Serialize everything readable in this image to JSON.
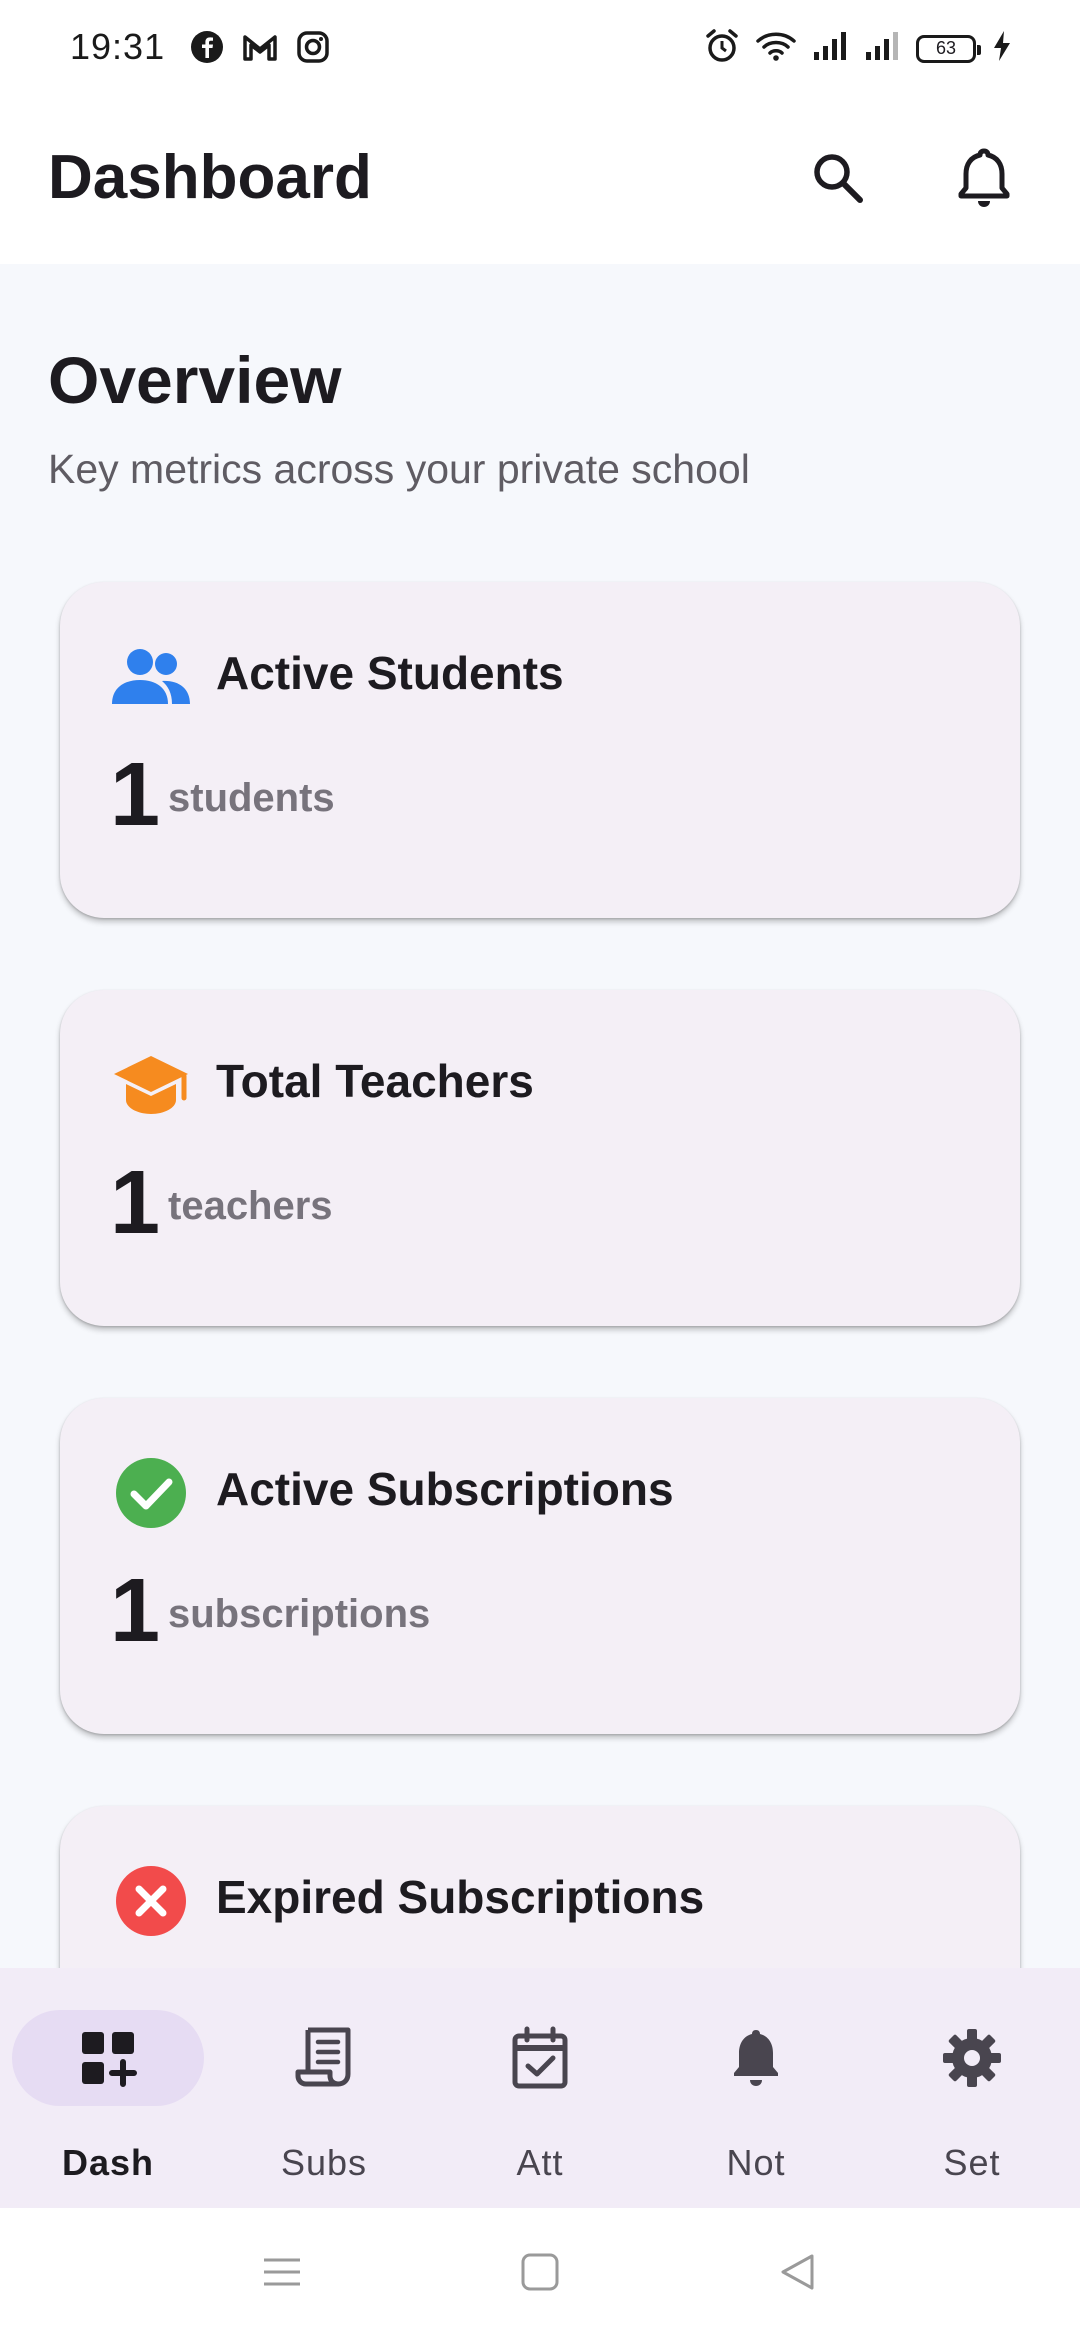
{
  "status_bar": {
    "time": "19:31",
    "app_icons": [
      "facebook-icon",
      "gmail-icon",
      "instagram-icon"
    ],
    "system_icons": [
      "alarm-icon",
      "wifi-icon",
      "signal-icon",
      "signal-icon"
    ],
    "battery": "63"
  },
  "app_bar": {
    "title": "Dashboard",
    "actions": [
      "search-icon",
      "bell-icon"
    ]
  },
  "overview": {
    "title": "Overview",
    "subtitle": "Key metrics across your private school"
  },
  "cards": [
    {
      "icon": "people-icon",
      "icon_color": "#2f80ed",
      "title": "Active Students",
      "value": "1",
      "unit": "students"
    },
    {
      "icon": "graduation-cap-icon",
      "icon_color": "#f68b1f",
      "title": "Total Teachers",
      "value": "1",
      "unit": "teachers"
    },
    {
      "icon": "check-circle-icon",
      "icon_color": "#4caf50",
      "title": "Active Subscriptions",
      "value": "1",
      "unit": "subscriptions"
    },
    {
      "icon": "cancel-circle-icon",
      "icon_color": "#f24b4b",
      "title": "Expired Subscriptions",
      "value": "",
      "unit": ""
    }
  ],
  "bottom_nav": {
    "items": [
      {
        "label": "Dash",
        "icon": "dashboard-add-icon",
        "active": true
      },
      {
        "label": "Subs",
        "icon": "receipt-icon",
        "active": false
      },
      {
        "label": "Att",
        "icon": "calendar-check-icon",
        "active": false
      },
      {
        "label": "Not",
        "icon": "bell-icon",
        "active": false
      },
      {
        "label": "Set",
        "icon": "gear-icon",
        "active": false
      }
    ]
  },
  "colors": {
    "background": "#f6f8fc",
    "card": "#f4eff6",
    "nav_background": "#f2ecf7",
    "nav_active_pill": "#e6dcf3"
  }
}
